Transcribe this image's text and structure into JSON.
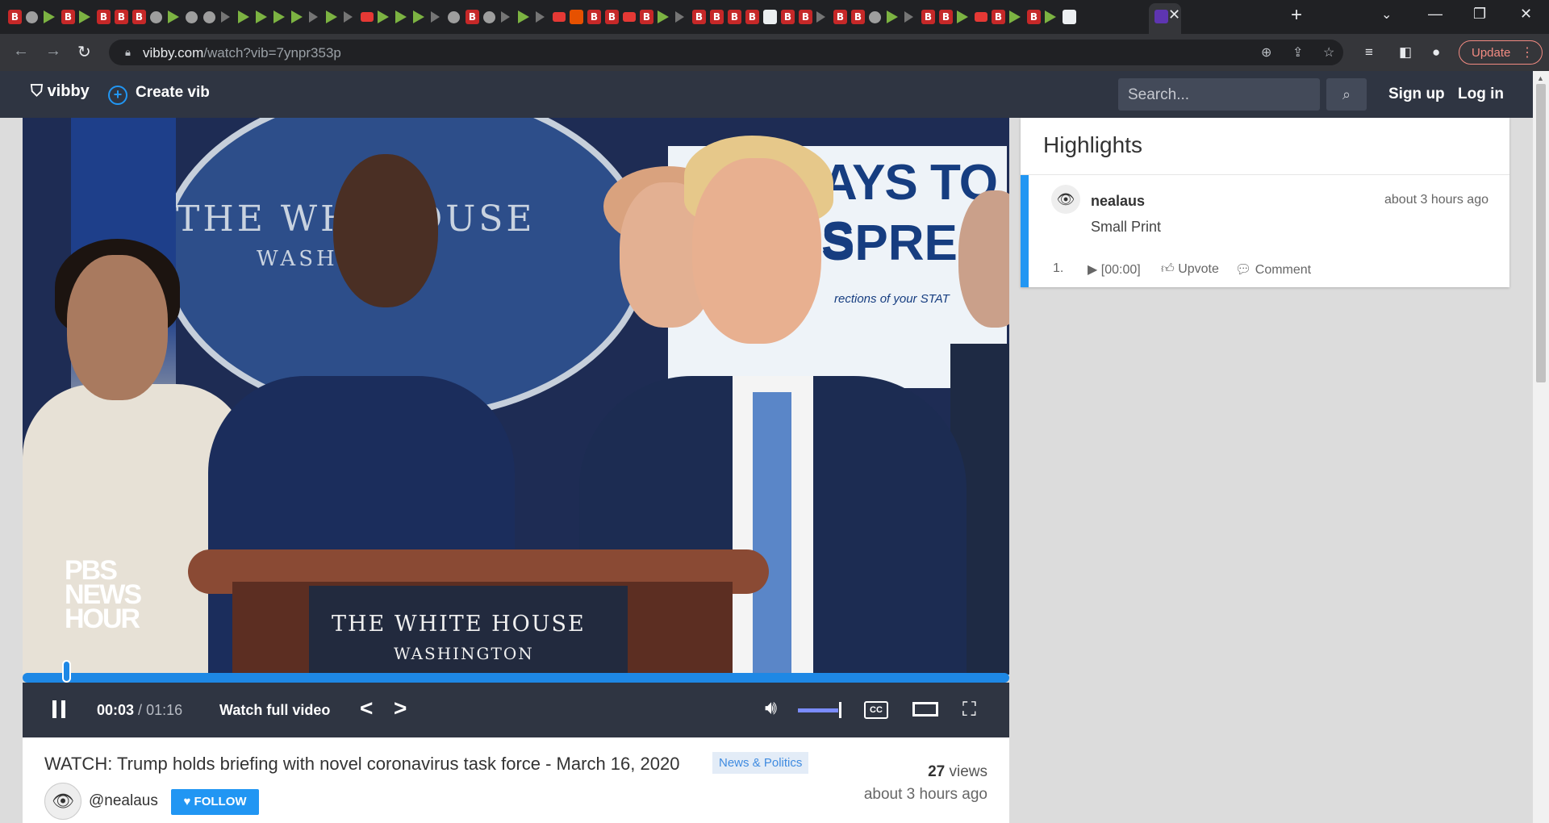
{
  "browser": {
    "url_host": "vibby.com",
    "url_path": "/watch?vib=7ynpr353p",
    "update_label": "Update",
    "new_tab_label": "+",
    "close_tab_label": "✕"
  },
  "site": {
    "logo_text": "vibby",
    "create_label": "Create vib",
    "search_placeholder": "Search...",
    "signup_label": "Sign up",
    "login_label": "Log in"
  },
  "video": {
    "frame_sign_line1": "AYS TO S",
    "frame_sign_line2": "SPREA",
    "frame_sign_small": "rections of your STAT",
    "frame_seal_text": "THE WHIT  OUSE",
    "frame_seal_sub": "WASHI",
    "podium_line1": "THE WHITE HOUSE",
    "podium_line2": "WASHINGTON",
    "watermark": "PBS NEWS HOUR",
    "progress_fraction": 0.04
  },
  "controls": {
    "current_time": "00:03",
    "separator": " / ",
    "duration": "01:16",
    "watch_full_label": "Watch full video",
    "cc_label": "CC",
    "volume_fraction": 1.0
  },
  "info": {
    "title": "WATCH: Trump holds briefing with novel coronavirus task force - March 16, 2020",
    "category": "News & Politics",
    "views_count": "27",
    "views_label": " views",
    "posted": "about 3 hours ago",
    "uploader": "@nealaus",
    "follow_label": "FOLLOW"
  },
  "highlights": {
    "title": "Highlights",
    "items": [
      {
        "user": "nealaus",
        "time": "about 3 hours ago",
        "text": "Small Print",
        "index": "1.",
        "timestamp": "[00:00]",
        "upvote_label": "Upvote",
        "comment_label": "Comment"
      }
    ]
  }
}
